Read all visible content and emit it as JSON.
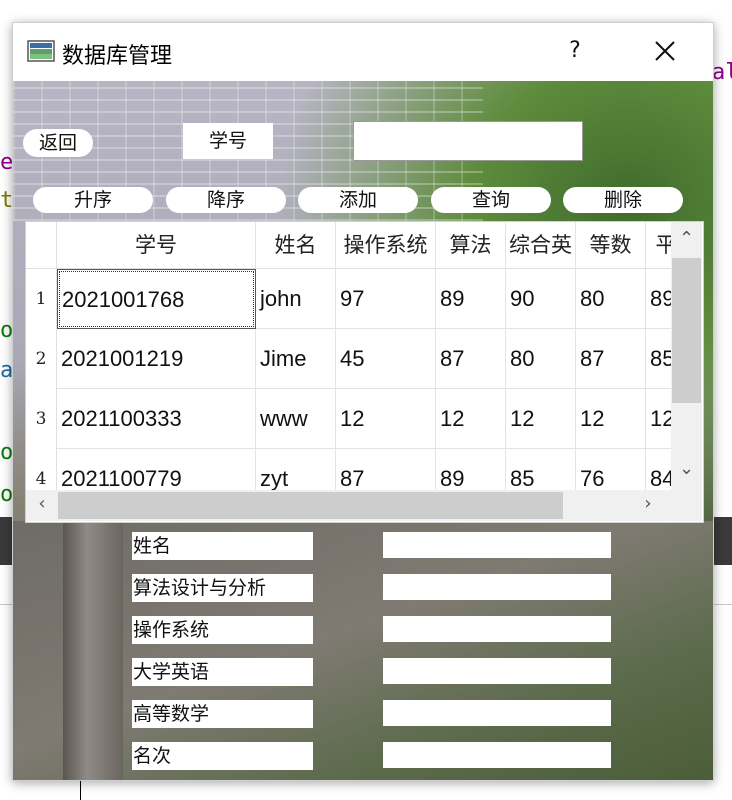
{
  "window": {
    "title": "数据库管理",
    "help_label": "?",
    "close_label": "✕"
  },
  "background": {
    "chars": [
      "e",
      "t",
      "o",
      "a",
      "o",
      "o"
    ],
    "snippet_right": "al"
  },
  "search": {
    "back_label": "返回",
    "id_label": "学号",
    "id_value": ""
  },
  "toolbar": {
    "ascending_label": "升序",
    "descending_label": "降序",
    "add_label": "添加",
    "query_label": "查询",
    "delete_label": "删除"
  },
  "table": {
    "columns": [
      "学号",
      "姓名",
      "操作系统",
      "算法",
      "综合英语",
      "高等数学",
      "平"
    ],
    "column_visible_text": [
      "学号",
      "姓名",
      "操作系统",
      "算法",
      "综合英",
      "等数",
      "平"
    ],
    "rows": [
      {
        "num": "1",
        "cells": [
          "2021001768",
          "john",
          "97",
          "89",
          "90",
          "80",
          "89"
        ]
      },
      {
        "num": "2",
        "cells": [
          "2021001219",
          "Jime",
          "45",
          "87",
          "80",
          "87",
          "85"
        ]
      },
      {
        "num": "3",
        "cells": [
          "2021100333",
          "www",
          "12",
          "12",
          "12",
          "12",
          "12"
        ]
      },
      {
        "num": "4",
        "cells": [
          "2021100779",
          "zyt",
          "87",
          "89",
          "85",
          "76",
          "84"
        ]
      }
    ]
  },
  "form": {
    "fields": [
      {
        "label": "姓名",
        "value": ""
      },
      {
        "label": "算法设计与分析",
        "value": ""
      },
      {
        "label": "操作系统",
        "value": ""
      },
      {
        "label": "大学英语",
        "value": ""
      },
      {
        "label": "高等数学",
        "value": ""
      },
      {
        "label": "名次",
        "value": ""
      }
    ]
  },
  "colors": {
    "accent": "#ffffff",
    "border": "#9a9a9a",
    "scroll_thumb": "#cdcdcd"
  }
}
